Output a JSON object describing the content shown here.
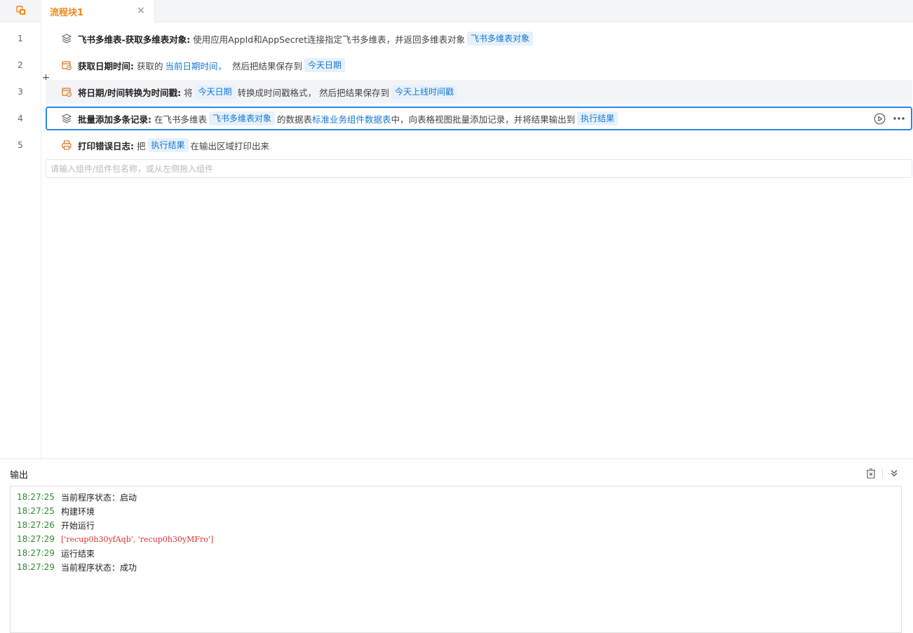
{
  "tabs": {
    "active_label": "流程块1",
    "close_glyph": "×"
  },
  "lines": [
    "1",
    "2",
    "3",
    "4",
    "5"
  ],
  "steps": [
    {
      "icon": "layers-icon",
      "title": "飞书多维表-获取多维表对象:",
      "text1": "使用应用AppId和AppSecret连接指定飞书多维表，并返回多维表对象",
      "chip1": "飞书多维表对象"
    },
    {
      "icon": "calendar-clock-icon",
      "title": "获取日期时间:",
      "text1": "获取的",
      "link1": "当前日期时间，",
      "text2": "然后把结果保存到",
      "chip1": "今天日期"
    },
    {
      "icon": "date-convert-icon",
      "title": "将日期/时间转换为时间戳:",
      "text1": "将",
      "chip1": "今天日期",
      "text2": "转换成时间戳格式，  然后把结果保存到",
      "chip2": "今天上线时间戳"
    },
    {
      "icon": "layers-icon",
      "title": "批量添加多条记录:",
      "text1": "在飞书多维表",
      "chip1": "飞书多维表对象",
      "text2": "的数据表",
      "link1": "标准业务组件数据表",
      "text3": "中，向表格视图批量添加记录，并将结果输出到",
      "chip2": "执行结果"
    },
    {
      "icon": "printer-icon",
      "title": "打印错误日志:",
      "text1": "把",
      "chip1": "执行结果",
      "text2": "在输出区域打印出来"
    }
  ],
  "component_input": {
    "placeholder": "请输入组件/组件包名称，或从左侧拖入组件"
  },
  "output": {
    "title": "输出",
    "logs": [
      {
        "time": "18:27:25",
        "msg": "当前程序状态：启动"
      },
      {
        "time": "18:27:25",
        "msg": "构建环境"
      },
      {
        "time": "18:27:26",
        "msg": "开始运行"
      },
      {
        "time": "18:27:29",
        "msg": "['recup0h30yfAqb', 'recup0h30yMFro']"
      },
      {
        "time": "18:27:29",
        "msg": "运行结束"
      },
      {
        "time": "18:27:29",
        "msg": "当前程序状态：成功"
      }
    ]
  },
  "colors": {
    "accent_orange": "#f0891a",
    "link_blue": "#1677d2",
    "chip_bg": "#e6f1fc",
    "selected_border": "#2b86e6",
    "log_time_green": "#2e8b2e",
    "log_error_red": "#d8322c"
  }
}
